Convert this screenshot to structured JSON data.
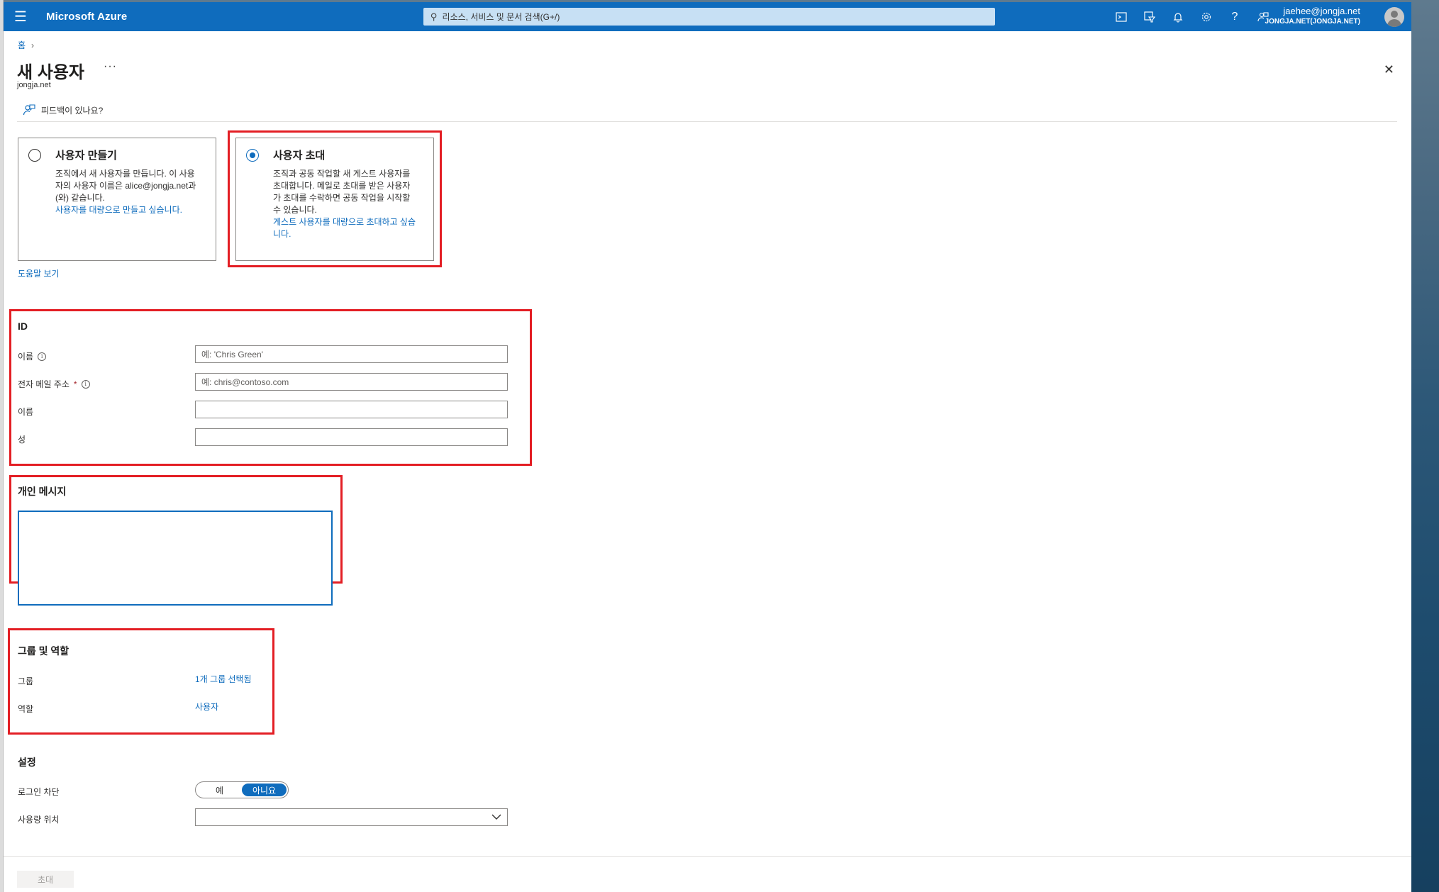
{
  "topbar": {
    "menu_icon": "hamburger-icon",
    "brand": "Microsoft Azure",
    "search_placeholder": "리소스, 서비스 및 문서 검색(G+/)",
    "icons": [
      "cloud-shell-icon",
      "directory-filter-icon",
      "notifications-icon",
      "settings-icon",
      "help-icon",
      "feedback-icon"
    ],
    "account_email": "jaehee@jongja.net",
    "account_tenant": "JONGJA.NET(JONGJA.NET)"
  },
  "breadcrumb": {
    "home": "홈"
  },
  "page": {
    "title": "새 사용자",
    "more": "···",
    "subtitle": "jongja.net",
    "feedback": "피드백이 있나요?"
  },
  "options": {
    "create": {
      "title": "사용자 만들기",
      "desc_lines": [
        "조직에서 새 사용자를 만듭니다. 이 사용",
        "자의 사용자 이름은 alice@jongja.net과",
        "(와) 같습니다."
      ],
      "link": "사용자를 대량으로 만들고 싶습니다.",
      "selected": false
    },
    "invite": {
      "title": "사용자 초대",
      "desc_lines": [
        "조직과 공동 작업할 새 게스트 사용자를",
        "초대합니다. 메일로 초대를 받은 사용자",
        "가 초대를 수락하면 공동 작업을 시작할",
        "수 있습니다."
      ],
      "link_lines": [
        "게스트 사용자를 대량으로 초대하고 싶습",
        "니다."
      ],
      "selected": true
    },
    "help_link": "도움말 보기"
  },
  "identity": {
    "title": "ID",
    "name_label": "이름",
    "name_placeholder": "예: 'Chris Green'",
    "email_label": "전자 메일 주소",
    "email_required": "*",
    "email_placeholder": "예: chris@contoso.com",
    "first_name_label": "이름",
    "last_name_label": "성"
  },
  "message": {
    "title": "개인 메시지"
  },
  "groups_roles": {
    "title": "그룹 및 역할",
    "groups_label": "그룹",
    "groups_value": "1개 그룹 선택됨",
    "roles_label": "역할",
    "roles_value": "사용자"
  },
  "settings": {
    "title": "설정",
    "block_signin_label": "로그인 차단",
    "toggle_yes": "예",
    "toggle_no": "아니요",
    "toggle_selected": "아니요",
    "usage_location_label": "사용량 위치",
    "usage_location_value": ""
  },
  "footer": {
    "invite_button": "초대",
    "invite_enabled": false
  },
  "colors": {
    "azure_blue": "#0f6cbd",
    "highlight_red": "#e31e24"
  }
}
